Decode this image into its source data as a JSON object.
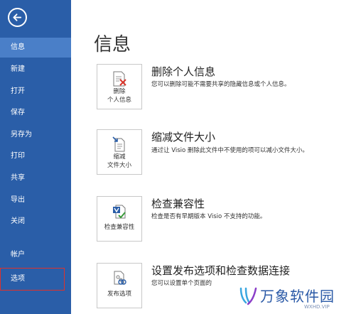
{
  "sidebar": {
    "items": [
      {
        "label": "信息"
      },
      {
        "label": "新建"
      },
      {
        "label": "打开"
      },
      {
        "label": "保存"
      },
      {
        "label": "另存为"
      },
      {
        "label": "打印"
      },
      {
        "label": "共享"
      },
      {
        "label": "导出"
      },
      {
        "label": "关闭"
      },
      {
        "label": "帐户"
      },
      {
        "label": "选项"
      }
    ],
    "active_color": "#4a7fc8",
    "bg_color": "#2a5ea8"
  },
  "main": {
    "title": "信息",
    "sections": [
      {
        "icon": "remove-personal-info-icon",
        "button_line1": "删除",
        "button_line2": "个人信息",
        "title": "删除个人信息",
        "desc": "您可以删除可能不需要共享的隐藏信息或个人信息。"
      },
      {
        "icon": "reduce-file-size-icon",
        "button_line1": "缩减",
        "button_line2": "文件大小",
        "title": "缩减文件大小",
        "desc": "通过让 Visio 删除此文件中不使用的项可以减小文件大小。"
      },
      {
        "icon": "check-compatibility-icon",
        "button_line1": "检查兼容性",
        "button_line2": "",
        "title": "检查兼容性",
        "desc": "检查是否有早期版本 Visio 不支持的功能。"
      },
      {
        "icon": "publish-options-icon",
        "button_line1": "发布选项",
        "button_line2": "",
        "title": "设置发布选项和检查数据连接",
        "desc": "您可以设置单个页面的"
      }
    ]
  },
  "watermark": {
    "text": "万象软件园",
    "sub": "WXHD.VIP"
  }
}
